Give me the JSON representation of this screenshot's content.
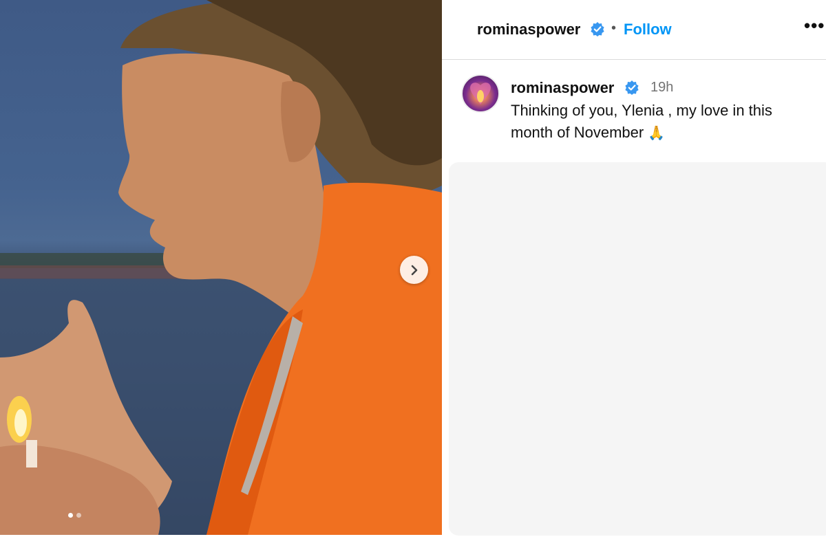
{
  "post": {
    "username": "rominaspower",
    "verified": true,
    "follow_label": "Follow",
    "separator": "•",
    "more_label": "•••",
    "timestamp": "19h",
    "caption": "Thinking of you, Ylenia , my love in this month of November",
    "caption_emoji": "🙏"
  },
  "carousel": {
    "image_count": 2,
    "active_index": 0
  },
  "colors": {
    "accent": "#0095f6",
    "verified_badge": "#3897f0"
  },
  "icons": {
    "next": "chevron-right-icon",
    "verified": "verified-badge-icon",
    "more": "more-options-icon"
  }
}
